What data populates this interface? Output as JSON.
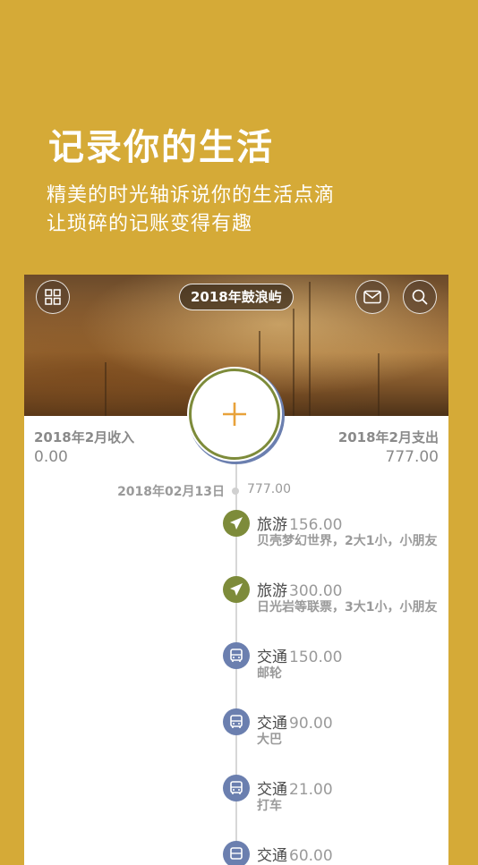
{
  "promo": {
    "title": "记录你的生活",
    "subtitle_line1": "精美的时光轴诉说你的生活点滴",
    "subtitle_line2": "让琐碎的记账变得有趣"
  },
  "header": {
    "album_title": "2018年鼓浪屿"
  },
  "summary": {
    "income_label": "2018年2月收入",
    "income_value": "0.00",
    "expense_label": "2018年2月支出",
    "expense_value": "777.00"
  },
  "timeline": {
    "date": "2018年02月13日",
    "day_total": "777.00",
    "entries": [
      {
        "category": "旅游",
        "amount": "156.00",
        "note": "贝壳梦幻世界，2大1小，小朋友",
        "icon": "airplane-icon",
        "color": "#7D8B3A"
      },
      {
        "category": "旅游",
        "amount": "300.00",
        "note": "日光岩等联票，3大1小，小朋友",
        "icon": "airplane-icon",
        "color": "#7D8B3A"
      },
      {
        "category": "交通",
        "amount": "150.00",
        "note": "邮轮",
        "icon": "bus-icon",
        "color": "#6B7FAF"
      },
      {
        "category": "交通",
        "amount": "90.00",
        "note": "大巴",
        "icon": "bus-icon",
        "color": "#6B7FAF"
      },
      {
        "category": "交通",
        "amount": "21.00",
        "note": "打车",
        "icon": "bus-icon",
        "color": "#6B7FAF"
      },
      {
        "category": "交通",
        "amount": "60.00",
        "note": "",
        "icon": "bus-icon",
        "color": "#6B7FAF"
      }
    ]
  }
}
